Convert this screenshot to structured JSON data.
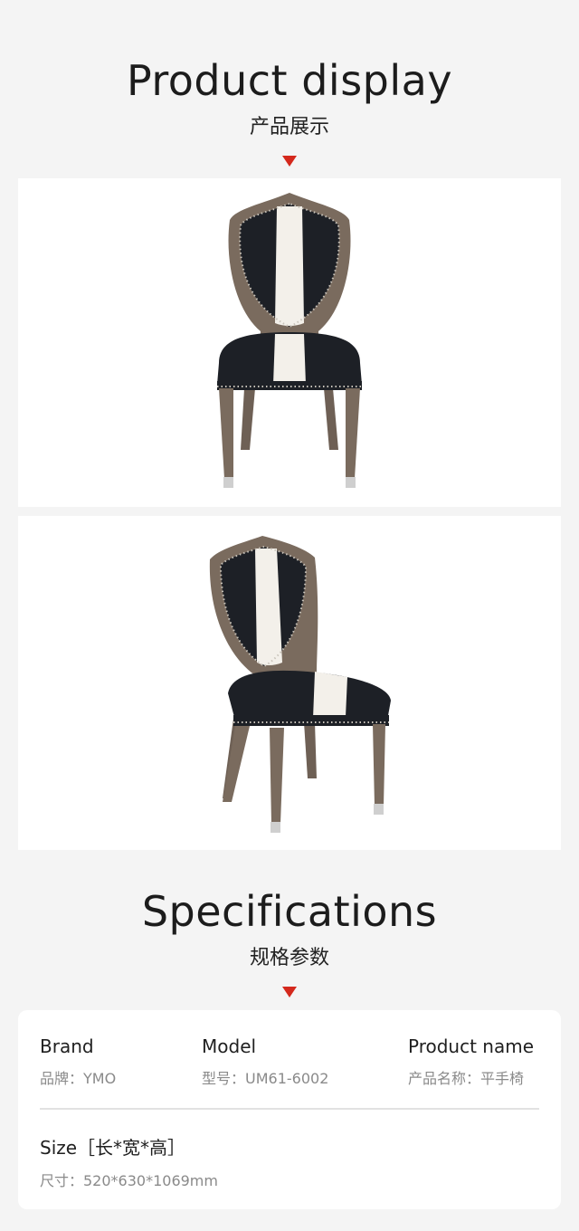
{
  "display": {
    "title_en": "Product display",
    "title_cn": "产品展示"
  },
  "specs_section": {
    "title_en": "Specifications",
    "title_cn": "规格参数"
  },
  "specs": {
    "brand_label": "Brand",
    "brand_value": "品牌：YMO",
    "model_label": "Model",
    "model_value": "型号：UM61-6002",
    "name_label": "Product name",
    "name_value": "产品名称：平手椅",
    "size_label": "Size［长*宽*高］",
    "size_value": "尺寸：520*630*1069mm"
  },
  "colors": {
    "accent": "#d4281c",
    "wood": "#7a6b5e",
    "leather": "#1d2026",
    "stripe": "#f3f0ea",
    "background": "#f4f4f4"
  }
}
